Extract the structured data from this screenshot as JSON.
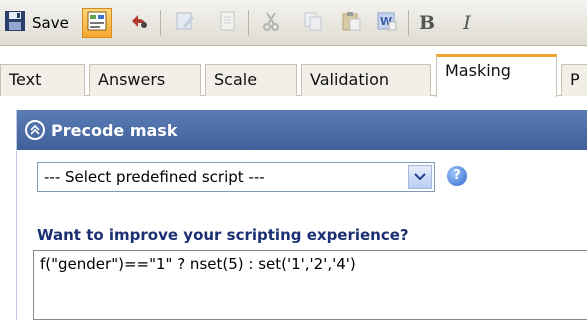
{
  "toolbar": {
    "save_label": "Save",
    "icons": [
      "save-icon",
      "question-properties-icon",
      "undo-icon",
      "edit-icon",
      "page-icon",
      "cut-icon",
      "copy-icon",
      "paste-icon",
      "paste-word-icon",
      "bold-icon",
      "italic-icon"
    ],
    "bold_glyph": "B",
    "italic_glyph": "I"
  },
  "tabs": [
    {
      "label": "Text"
    },
    {
      "label": "Answers"
    },
    {
      "label": "Scale"
    },
    {
      "label": "Validation"
    },
    {
      "label": "Masking",
      "active": true
    },
    {
      "label": "P"
    }
  ],
  "panel": {
    "title": "Precode mask",
    "select_value": "--- Select predefined script ---",
    "help_glyph": "?",
    "improve_text": "Want to improve your scripting experience?",
    "code": "f(\"gender\")==\"1\" ? nset(5) : set('1','2','4')"
  },
  "colors": {
    "panel_header": "#4a6aa5",
    "active_tab_accent": "#f0a22c",
    "link_text": "#1c2f72"
  }
}
